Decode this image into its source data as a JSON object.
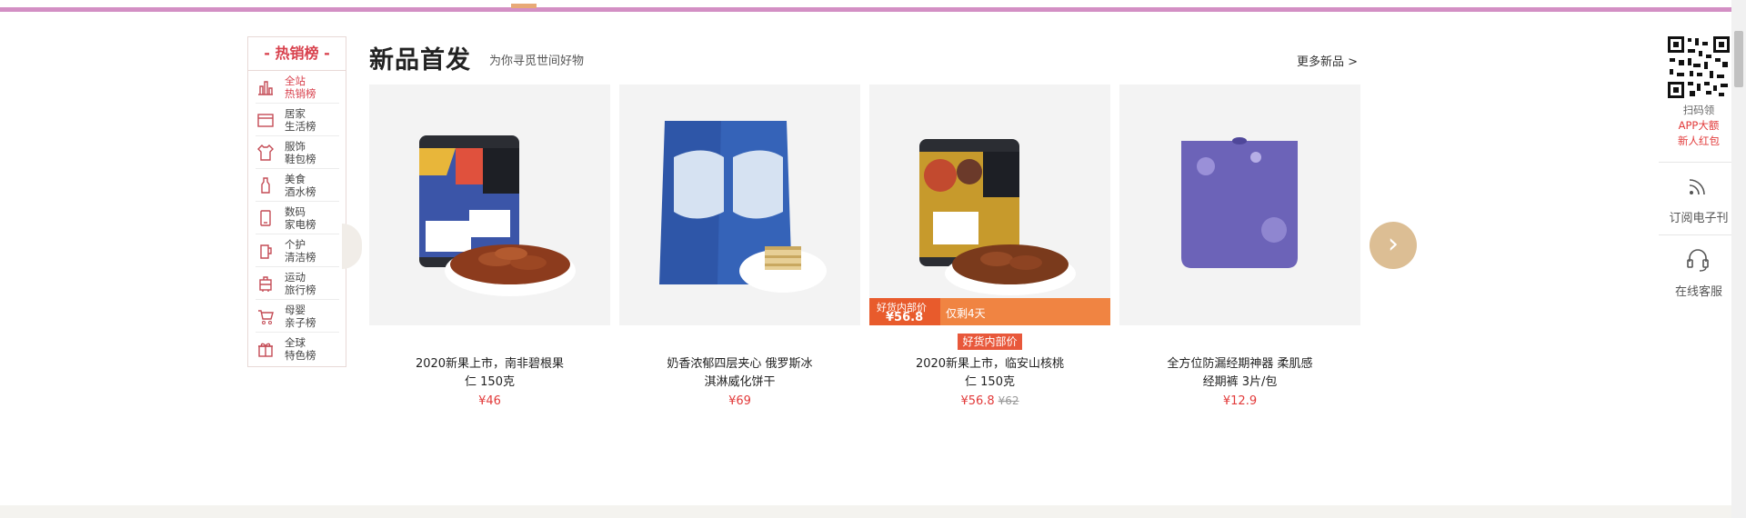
{
  "rank_panel": {
    "title": "- 热销榜 -",
    "items": [
      {
        "line1": "全站",
        "line2": "热销榜",
        "icon": "bar-chart-icon",
        "active": true
      },
      {
        "line1": "居家",
        "line2": "生活榜",
        "icon": "home-appliance-icon"
      },
      {
        "line1": "服饰",
        "line2": "鞋包榜",
        "icon": "shirt-icon"
      },
      {
        "line1": "美食",
        "line2": "酒水榜",
        "icon": "bottle-icon"
      },
      {
        "line1": "数码",
        "line2": "家电榜",
        "icon": "phone-icon"
      },
      {
        "line1": "个护",
        "line2": "清洁榜",
        "icon": "cup-icon"
      },
      {
        "line1": "运动",
        "line2": "旅行榜",
        "icon": "luggage-icon"
      },
      {
        "line1": "母婴",
        "line2": "亲子榜",
        "icon": "stroller-icon"
      },
      {
        "line1": "全球",
        "line2": "特色榜",
        "icon": "gift-icon"
      }
    ]
  },
  "section": {
    "title": "新品首发",
    "subtitle": "为你寻觅世间好物",
    "more": "更多新品 >"
  },
  "products": [
    {
      "name_line1": "2020新果上市，南非碧根果",
      "name_line2": "仁 150克",
      "price": "¥46"
    },
    {
      "name_line1": "奶香浓郁四层夹心 俄罗斯冰",
      "name_line2": "淇淋威化饼干",
      "price": "¥69"
    },
    {
      "name_line1": "2020新果上市，临安山核桃",
      "name_line2": "仁 150克",
      "price": "¥56.8",
      "old_price": "¥62",
      "tag": "好货内部价",
      "promo": {
        "label": "好货内部价",
        "price": "¥56.8",
        "countdown": "仅剩4天"
      }
    },
    {
      "name_line1": "全方位防漏经期神器 柔肌感",
      "name_line2": "经期裤 3片/包",
      "price": "¥12.9"
    }
  ],
  "sidebar": {
    "qr_line1": "扫码领",
    "qr_line2": "APP大额",
    "qr_line3": "新人红包",
    "subscribe": "订阅电子刊",
    "service": "在线客服"
  },
  "colors": {
    "accent_red": "#d8414d",
    "price_red": "#e23a3a",
    "promo_orange": "#f08442",
    "arrow_gold": "#dcbe94",
    "top_line": "#d38fc4"
  }
}
